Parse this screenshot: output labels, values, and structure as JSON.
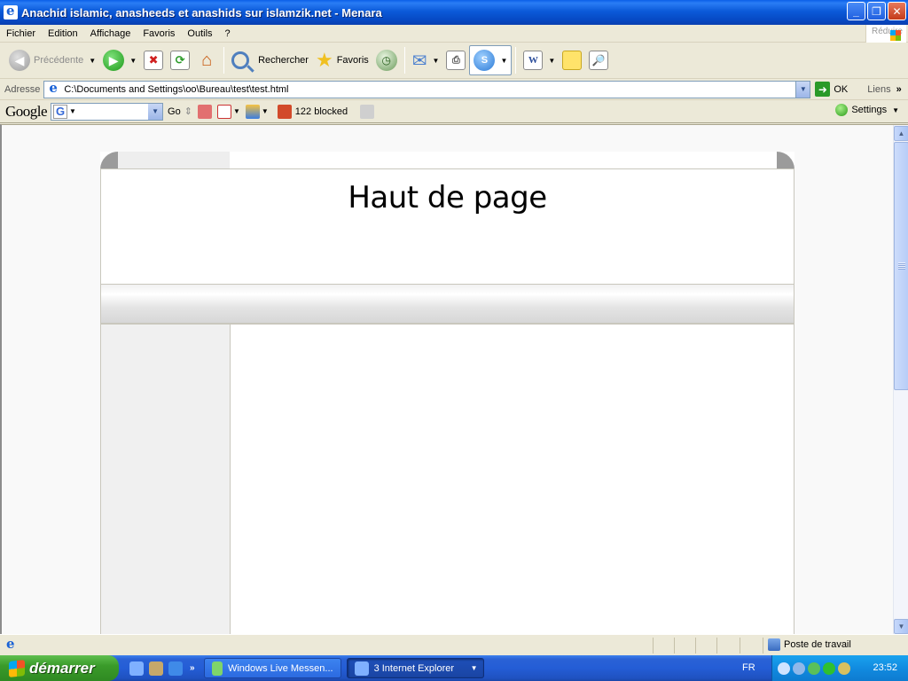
{
  "window": {
    "title": "Anachid islamic, anasheeds et anashids sur islamzik.net - Menara",
    "buttons": {
      "minimize": "_",
      "maximize": "❐",
      "close": "✕"
    },
    "xp_hint": "Réduire"
  },
  "menu": {
    "items": [
      "Fichier",
      "Edition",
      "Affichage",
      "Favoris",
      "Outils",
      "?"
    ]
  },
  "toolbar": {
    "back_label": "Précédente",
    "search_label": "Rechercher",
    "favorites_label": "Favoris"
  },
  "address": {
    "label": "Adresse",
    "url": "C:\\Documents and Settings\\oo\\Bureau\\test\\test.html",
    "go_label": "OK",
    "links_label": "Liens"
  },
  "google_bar": {
    "logo": "Google",
    "go_label": "Go",
    "blocked_label": "122 blocked",
    "settings_label": "Settings"
  },
  "page": {
    "header_title": "Haut de page"
  },
  "status": {
    "zone_label": "Poste de travail"
  },
  "taskbar": {
    "start_label": "démarrer",
    "tasks": [
      {
        "label": "Windows Live Messen..."
      },
      {
        "label": "3 Internet Explorer"
      }
    ],
    "tray": {
      "language": "FR",
      "clock": "23:52"
    }
  },
  "colors": {
    "titlebar": "#0b5ad9",
    "taskbar": "#245dd6",
    "start": "#3a9b2a",
    "tray": "#118be0",
    "chrome": "#ece9d8"
  }
}
